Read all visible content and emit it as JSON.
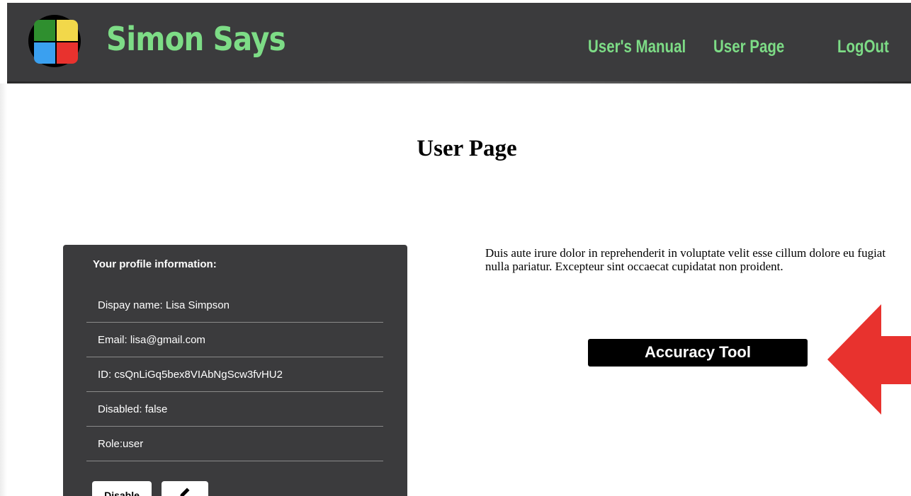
{
  "header": {
    "brand_name": "Simon Says",
    "nav": {
      "manual_label": "User's Manual",
      "user_page_label": "User Page",
      "logout_label": "LogOut"
    }
  },
  "main": {
    "title": "User Page",
    "description": "Duis aute irure dolor in reprehenderit in voluptate velit esse cillum dolore eu fugiat nulla pariatur. Excepteur sint occaecat cupidatat non proident.",
    "accuracy_tool_label": "Accuracy Tool"
  },
  "profile": {
    "heading": "Your profile information:",
    "rows": [
      "Dispay name: Lisa Simpson",
      "Email: lisa@gmail.com",
      "ID: csQnLiGq5bex8VIAbNgScw3fvHU2",
      "Disabled: false",
      "Role:user"
    ],
    "disable_label": "Disable"
  },
  "colors": {
    "header_bg": "#3b3b3d",
    "brand_green": "#7ddc86",
    "arrow_red": "#e8322e",
    "button_black": "#000000"
  },
  "icons": {
    "edit": "pencil-icon",
    "annotation": "arrow-left-icon",
    "logo": "simon-four-squares-logo"
  }
}
